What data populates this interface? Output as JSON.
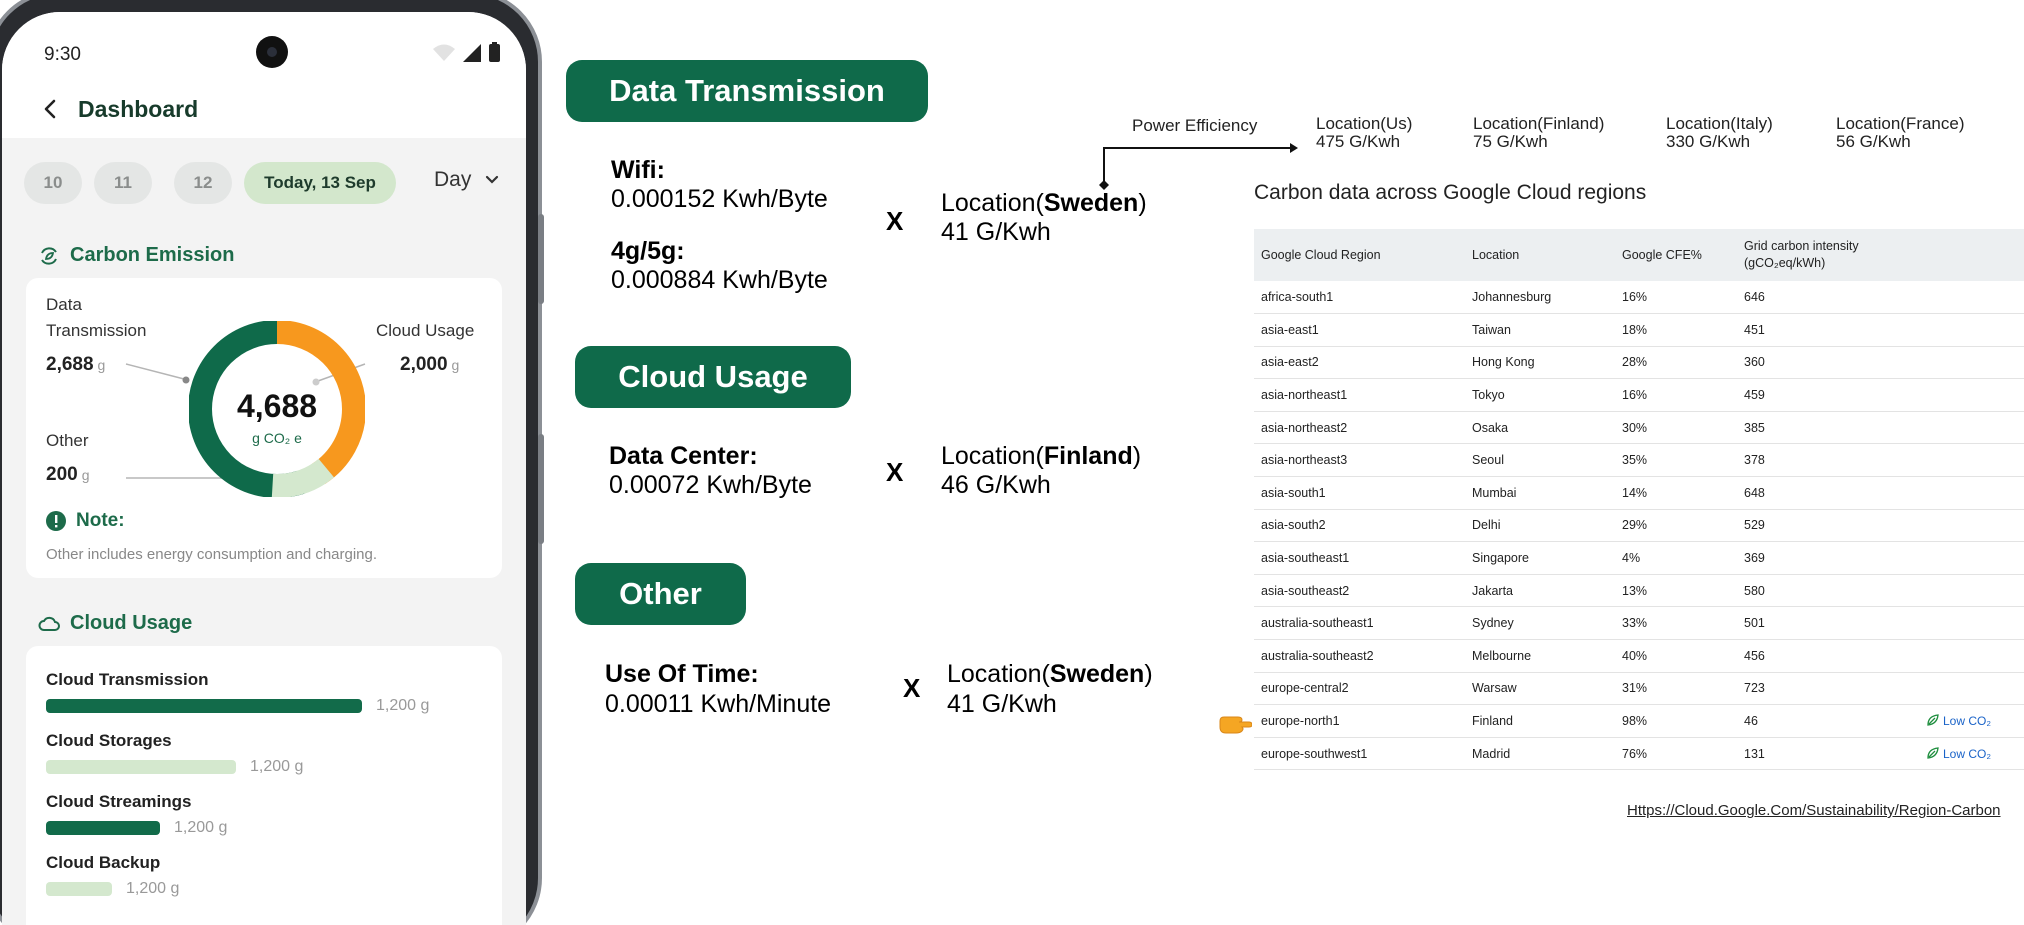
{
  "phone": {
    "status_time": "9:30",
    "title": "Dashboard",
    "dates": [
      "10",
      "11",
      "12",
      "Today, 13 Sep"
    ],
    "period": "Day",
    "carbon": {
      "title": "Carbon Emission",
      "total": "4,688",
      "total_unit": "g CO₂ e",
      "data_transmission": {
        "label_line1": "Data",
        "label_line2": "Transmission",
        "value": "2,688",
        "unit": "g"
      },
      "cloud_usage": {
        "label": "Cloud Usage",
        "value": "2,000",
        "unit": "g"
      },
      "other": {
        "label": "Other",
        "value": "200",
        "unit": "g"
      },
      "note_title": "Note:",
      "note_text": "Other includes energy consumption and charging."
    },
    "cloud": {
      "title": "Cloud Usage",
      "items": [
        {
          "label": "Cloud Transmission",
          "value": "1,200 g",
          "fill": 1.0,
          "color": "#126b4a"
        },
        {
          "label": "Cloud Storages",
          "value": "1,200 g",
          "fill": 0.6,
          "color": "#d4e8ce"
        },
        {
          "label": "Cloud Streamings",
          "value": "1,200 g",
          "fill": 0.36,
          "color": "#126b4a"
        },
        {
          "label": "Cloud Backup",
          "value": "1,200 g",
          "fill": 0.21,
          "color": "#d4e8ce"
        }
      ]
    }
  },
  "chart_data": {
    "type": "pie",
    "title": "",
    "categories": [
      "Data Transmission",
      "Cloud Usage",
      "Other"
    ],
    "values": [
      2688,
      2000,
      200
    ],
    "colors": [
      "#0f6a4a",
      "#f7981e",
      "#d4e8ce"
    ]
  },
  "formulas": {
    "data_transmission": {
      "title": "Data Transmission",
      "wifi_label": "Wifi:",
      "wifi_value": "0.000152 Kwh/Byte",
      "g_label": "4g/5g:",
      "g_value": "0.000884 Kwh/Byte",
      "times": "X",
      "location_prefix": "Location(",
      "location_name": "Sweden",
      "location_suffix": ")",
      "intensity": "41  G/Kwh"
    },
    "cloud_usage": {
      "title": "Cloud Usage",
      "label": "Data Center:",
      "value": "0.00072 Kwh/Byte",
      "times": "X",
      "location_prefix": "Location(",
      "location_name": "Finland",
      "location_suffix": ")",
      "intensity": "46  G/Kwh"
    },
    "other": {
      "title": "Other",
      "label": "Use Of Time:",
      "value": "0.00011  Kwh/Minute",
      "times": "X",
      "location_prefix": "Location(",
      "location_name": "Sweden",
      "location_suffix": ")",
      "intensity": "41  G/Kwh"
    }
  },
  "power_efficiency": {
    "label": "Power Efficiency",
    "locations": [
      {
        "name": "Location(Us)",
        "value": "475  G/Kwh"
      },
      {
        "name": "Location(Finland)",
        "value": "75  G/Kwh"
      },
      {
        "name": "Location(Italy)",
        "value": "330  G/Kwh"
      },
      {
        "name": "Location(France)",
        "value": "56  G/Kwh"
      }
    ]
  },
  "carbon_table": {
    "title": "Carbon data across Google Cloud regions",
    "headers": [
      "Google Cloud Region",
      "Location",
      "Google CFE%",
      "Grid carbon intensity",
      "(gCO₂eq/kWh)",
      ""
    ],
    "rows": [
      [
        "africa-south1",
        "Johannesburg",
        "16%",
        "646",
        ""
      ],
      [
        "asia-east1",
        "Taiwan",
        "18%",
        "451",
        ""
      ],
      [
        "asia-east2",
        "Hong Kong",
        "28%",
        "360",
        ""
      ],
      [
        "asia-northeast1",
        "Tokyo",
        "16%",
        "459",
        ""
      ],
      [
        "asia-northeast2",
        "Osaka",
        "30%",
        "385",
        ""
      ],
      [
        "asia-northeast3",
        "Seoul",
        "35%",
        "378",
        ""
      ],
      [
        "asia-south1",
        "Mumbai",
        "14%",
        "648",
        ""
      ],
      [
        "asia-south2",
        "Delhi",
        "29%",
        "529",
        ""
      ],
      [
        "asia-southeast1",
        "Singapore",
        "4%",
        "369",
        ""
      ],
      [
        "asia-southeast2",
        "Jakarta",
        "13%",
        "580",
        ""
      ],
      [
        "australia-southeast1",
        "Sydney",
        "33%",
        "501",
        ""
      ],
      [
        "australia-southeast2",
        "Melbourne",
        "40%",
        "456",
        ""
      ],
      [
        "europe-central2",
        "Warsaw",
        "31%",
        "723",
        ""
      ],
      [
        "europe-north1",
        "Finland",
        "98%",
        "46",
        "Low CO₂"
      ],
      [
        "europe-southwest1",
        "Madrid",
        "76%",
        "131",
        "Low CO₂"
      ]
    ],
    "source": "Https://Cloud.Google.Com/Sustainability/Region-Carbon"
  }
}
